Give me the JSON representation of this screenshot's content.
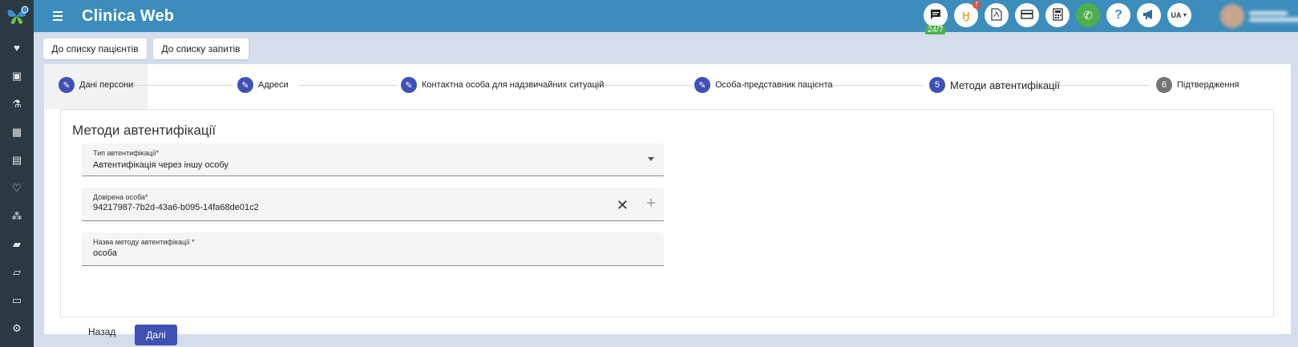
{
  "app": {
    "title": "Clinica Web"
  },
  "sidebar": {
    "icons": [
      "heart-icon",
      "contact-card-icon",
      "flask-icon",
      "calendar-icon",
      "document-icon",
      "heartbeat-icon",
      "molecules-icon",
      "book-icon",
      "folder-icon",
      "money-icon",
      "cogs-icon"
    ]
  },
  "header": {
    "chat_badge": "24/7",
    "notification_badge": "!",
    "language": "UA"
  },
  "nav": {
    "patients_list": "До списку пацієнтів",
    "requests_list": "До списку запитів"
  },
  "stepper": {
    "steps": [
      {
        "label": "Дані персони",
        "state": "done"
      },
      {
        "label": "Адреси",
        "state": "done"
      },
      {
        "label": "Контактна особа для надзвичайних ситуацій",
        "state": "done"
      },
      {
        "label": "Особа-представник пацієнта",
        "state": "done"
      },
      {
        "label": "Методи автентифікації",
        "number": "5",
        "state": "active"
      },
      {
        "label": "Підтвердження",
        "number": "6",
        "state": "pending"
      }
    ]
  },
  "form": {
    "title": "Методи автентифікації",
    "auth_type": {
      "label": "Тип автентифікації*",
      "value": "Автентифікація через іншу особу"
    },
    "trusted_person": {
      "label": "Довірена особа*",
      "value": "94217987-7b2d-43a6-b095-14fa68de01c2"
    },
    "method_name": {
      "label": "Назва методу автентифікації *",
      "value": "особа"
    },
    "back_label": "Назад",
    "next_label": "Далі"
  },
  "colors": {
    "topbar": "#3c8dbc",
    "sidebar": "#2b3a42",
    "primary": "#3f51b5",
    "background": "#d3ddeb"
  }
}
